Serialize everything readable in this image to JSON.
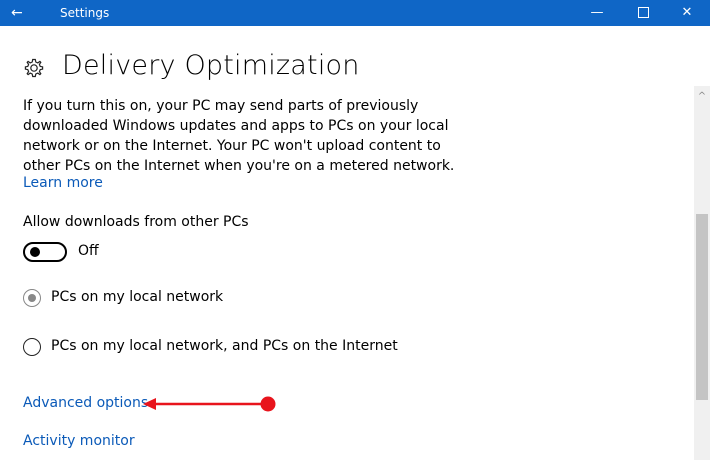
{
  "titlebar": {
    "back_glyph": "←",
    "title": "Settings",
    "minimize_glyph": "—",
    "close_glyph": "✕"
  },
  "page": {
    "title": "Delivery Optimization",
    "icon": "gear-icon",
    "description": "If you turn this on, your PC may send parts of previously downloaded Windows updates and apps to PCs on your local network or on the Internet. Your PC won't upload content to other PCs on the Internet when you're on a metered network.",
    "learn_more": "Learn more"
  },
  "allow_downloads": {
    "label": "Allow downloads from other PCs",
    "toggle_state": "Off"
  },
  "radios": [
    {
      "label": "PCs on my local network",
      "selected": true
    },
    {
      "label": "PCs on my local network, and PCs on the Internet",
      "selected": false
    }
  ],
  "links": {
    "advanced_options": "Advanced options",
    "activity_monitor": "Activity monitor"
  },
  "scrollbar": {
    "up_glyph": "^"
  },
  "colors": {
    "titlebar": "#0f66c6",
    "link": "#0b5ab8",
    "annotation_arrow": "#e8141c"
  }
}
